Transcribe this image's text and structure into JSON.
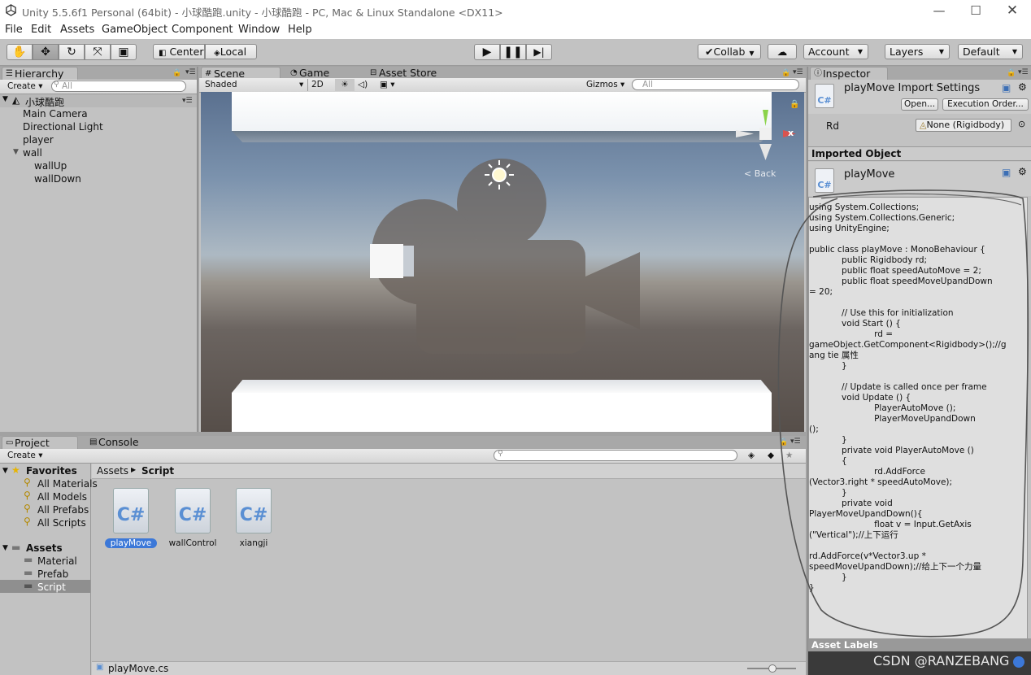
{
  "window": {
    "title": "Unity 5.5.6f1 Personal (64bit) - 小球酷跑.unity - 小球酷跑 - PC, Mac & Linux Standalone <DX11>"
  },
  "menu": [
    "File",
    "Edit",
    "Assets",
    "GameObject",
    "Component",
    "Window",
    "Help"
  ],
  "toolbar": {
    "pivot": "Center",
    "space": "Local",
    "collab": "Collab",
    "account": "Account",
    "layers": "Layers",
    "layout": "Default"
  },
  "hierarchy": {
    "tab": "Hierarchy",
    "create": "Create",
    "search_placeholder": "All",
    "scene": "小球酷跑",
    "items": [
      "Main Camera",
      "Directional Light",
      "player",
      "wall",
      "wallUp",
      "wallDown"
    ]
  },
  "scene": {
    "tabs": [
      "Scene",
      "Game",
      "Asset Store"
    ],
    "shading": "Shaded",
    "mode2d": "2D",
    "gizmos": "Gizmos",
    "search_placeholder": "All",
    "back_label": "Back",
    "axis_x": "x"
  },
  "project": {
    "tabs": [
      "Project",
      "Console"
    ],
    "create": "Create",
    "favorites_label": "Favorites",
    "favorites": [
      "All Materials",
      "All Models",
      "All Prefabs",
      "All Scripts"
    ],
    "assets_label": "Assets",
    "folders": [
      "Material",
      "Prefab",
      "Script"
    ],
    "breadcrumb": [
      "Assets",
      "Script"
    ],
    "files": [
      "playMove",
      "wallControl",
      "xiangji"
    ],
    "status_file": "playMove.cs"
  },
  "inspector": {
    "tab": "Inspector",
    "title": "playMove Import Settings",
    "open_btn": "Open...",
    "exec_btn": "Execution Order...",
    "field_label": "Rd",
    "field_value": "None (Rigidbody)",
    "section": "Imported Object",
    "object_name": "playMove",
    "code_lines": [
      "using System.Collections;",
      "using System.Collections.Generic;",
      "using UnityEngine;",
      "",
      "public class playMove : MonoBehaviour {",
      "            public Rigidbody rd;",
      "            public float speedAutoMove = 2;",
      "            public float speedMoveUpandDown",
      "= 20;",
      "",
      "            // Use this for initialization",
      "            void Start () {",
      "                        rd =",
      "gameObject.GetComponent<Rigidbody>();//g",
      "ang tie 属性",
      "            }",
      "",
      "            // Update is called once per frame",
      "            void Update () {",
      "                        PlayerAutoMove ();",
      "                        PlayerMoveUpandDown",
      "();",
      "            }",
      "            private void PlayerAutoMove ()",
      "            {",
      "                        rd.AddForce",
      "(Vector3.right * speedAutoMove);",
      "            }",
      "            private void",
      "PlayerMoveUpandDown(){",
      "                        float v = Input.GetAxis",
      "(\"Vertical\");//上下运行",
      "",
      "rd.AddForce(v*Vector3.up *",
      "speedMoveUpandDown);//给上下一个力量",
      "            }",
      "}"
    ],
    "asset_labels": "Asset Labels"
  },
  "watermark": "CSDN @RANZEBANG"
}
